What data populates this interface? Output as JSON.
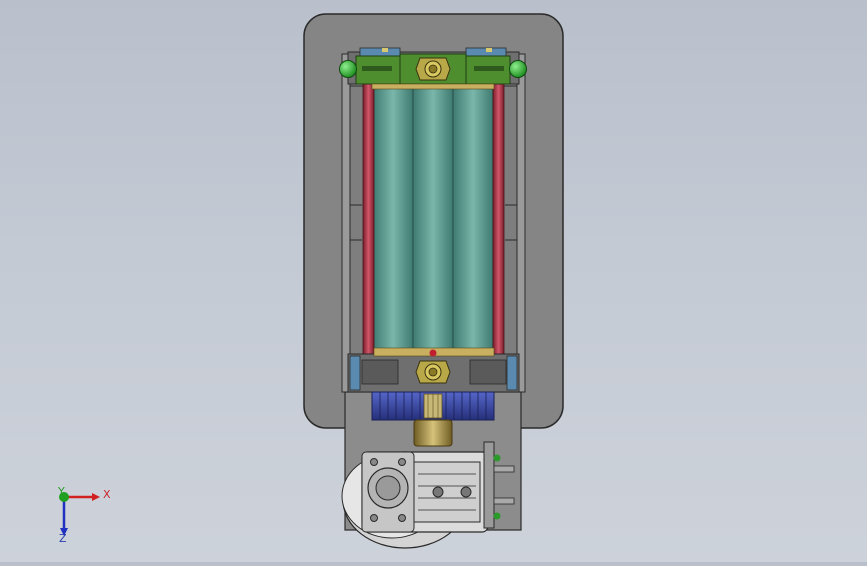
{
  "window": {
    "title": ""
  },
  "triad": {
    "x_label": "X",
    "y_label": "Y",
    "z_label": "Z",
    "x_color": "#d02020",
    "y_color": "#20a020",
    "z_color": "#2030c0"
  },
  "colors": {
    "background": "#c4cad4",
    "frame_plate": "#8a8a8a",
    "roller": "#5b9a8e",
    "rod": "#b03040",
    "bracket": "#4a8a2a",
    "gear": "#3e4fa8",
    "bronze": "#a89450"
  }
}
